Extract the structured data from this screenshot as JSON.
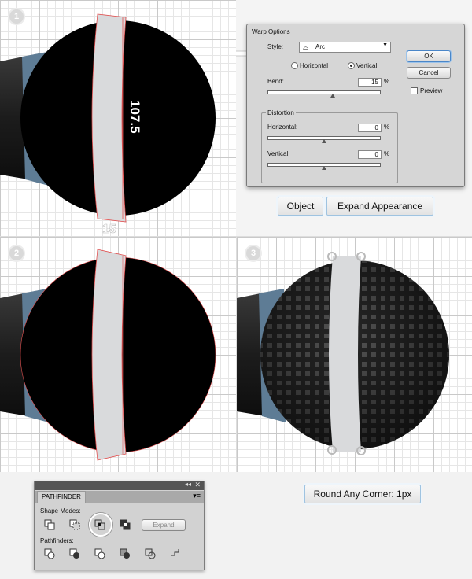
{
  "steps": [
    "1",
    "2",
    "3"
  ],
  "step1": {
    "dimension_vertical": "107.5",
    "dimension_horizontal": "15"
  },
  "warp_dialog": {
    "title": "Warp Options",
    "style_label": "Style:",
    "style_value": "Arc",
    "horizontal_label": "Horizontal",
    "vertical_label": "Vertical",
    "selected_orientation": "Vertical",
    "bend_label": "Bend:",
    "bend_value": "15",
    "percent": "%",
    "distortion_label": "Distortion",
    "dist_horizontal_label": "Horizontal:",
    "dist_horizontal_value": "0",
    "dist_vertical_label": "Vertical:",
    "dist_vertical_value": "0",
    "ok_label": "OK",
    "cancel_label": "Cancel",
    "preview_label": "Preview"
  },
  "menu_path": {
    "object": "Object",
    "expand_appearance": "Expand Appearance"
  },
  "round_corner": {
    "label": "Round Any Corner: 1px"
  },
  "pathfinder": {
    "tab": "PATHFINDER",
    "shape_modes_label": "Shape Modes:",
    "expand_label": "Expand",
    "pathfinders_label": "Pathfinders:"
  },
  "colors": {
    "ball": "#000000",
    "band": "#d9dadc",
    "guide": "#e05050",
    "handle_dark": "#2a2a2a",
    "handle_blue": "#5e7c95"
  }
}
